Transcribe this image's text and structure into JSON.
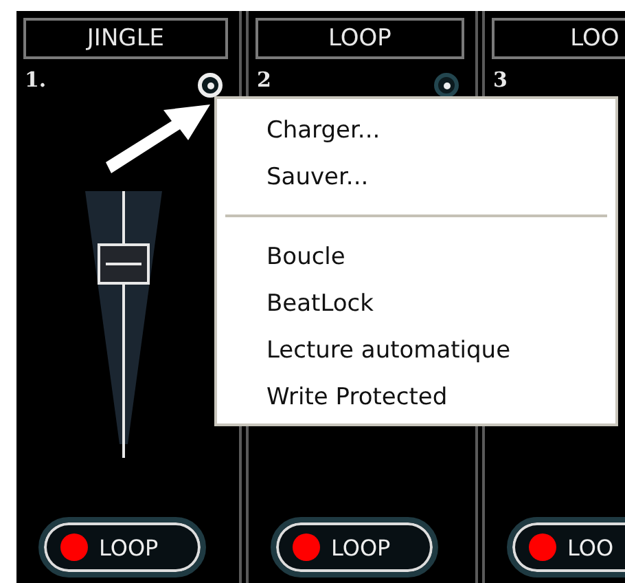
{
  "strips": [
    {
      "title": "JINGLE",
      "number": "1.",
      "knob_highlighted": true,
      "level": 0.77,
      "button": "LOOP"
    },
    {
      "title": "LOOP",
      "number": "2",
      "knob_highlighted": false,
      "button": "LOOP"
    },
    {
      "title": "LOO",
      "number": "3",
      "button": "LOO"
    }
  ],
  "context_menu": [
    {
      "kind": "item",
      "label": "Charger..."
    },
    {
      "kind": "item",
      "label": "Sauver..."
    },
    {
      "kind": "separator"
    },
    {
      "kind": "item",
      "label": "Boucle"
    },
    {
      "kind": "item",
      "label": "BeatLock"
    },
    {
      "kind": "item",
      "label": "Lecture automatique"
    },
    {
      "kind": "item",
      "label": "Write Protected"
    }
  ]
}
